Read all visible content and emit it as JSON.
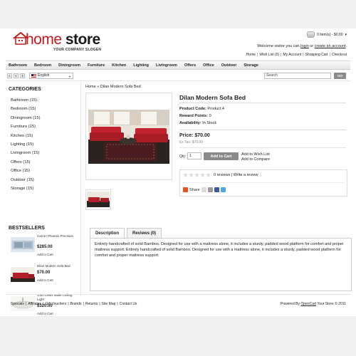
{
  "header": {
    "logo": {
      "home": "home",
      "store": "store"
    },
    "slogan": "YOUR COMPANY SLOGEN",
    "cart_text": "0 item(s) - $0.00",
    "welcome": {
      "prefix": "Welcome visitor you can ",
      "login": "login",
      "middle": " or ",
      "create": "create an account",
      "suffix": "."
    },
    "toplinks": [
      "Home",
      "Wish List (0)",
      "My Account",
      "Shopping Cart",
      "Checkout"
    ]
  },
  "menu": [
    "Bathroom",
    "Bedroom",
    "Diningroom",
    "Furniture",
    "Kitchen",
    "Lighting",
    "Livingroom",
    "Offers",
    "Office",
    "Outdoor",
    "Storage"
  ],
  "toolbar": {
    "currencies": [
      "£",
      "€",
      "$"
    ],
    "language": "English",
    "search_placeholder": "Search",
    "go_label": "GO"
  },
  "sidebar": {
    "categories_title": "CATEGORIES",
    "categories": [
      "Bathroom (15)",
      "Bedroom (15)",
      "Diningroom (15)",
      "Furniture (15)",
      "Kitchen (15)",
      "Lighting (15)",
      "Livingroom (15)",
      "Offers (15)",
      "Office (15)",
      "Outdoor (15)",
      "Storage (15)"
    ],
    "bestsellers_title": "BESTSELLERS",
    "bestsellers": [
      {
        "name": "Carron Phoenix Precision",
        "price": "$285.00",
        "cart": "Add to Cart"
      },
      {
        "name": "Dilan Modern Sofa Bed",
        "price": "$70.00",
        "cart": "Add to Cart"
      },
      {
        "name": "John Lewis Malie Ceiling Light",
        "price": "$320.00",
        "cart": "Add to Cart"
      }
    ]
  },
  "breadcrumb": {
    "home": "Home",
    "sep": "»",
    "current": "Dilan Modern Sofa Bed"
  },
  "product": {
    "title": "Dilan Modern Sofa Bed",
    "code_label": "Product Code:",
    "code_value": "Product 4",
    "reward_label": "Reward Points:",
    "reward_value": "0",
    "avail_label": "Availability:",
    "avail_value": "In Stock",
    "price": "Price: $70.00",
    "ex_tax": "Ex Tax: $70.00",
    "qty_label": "Qty:",
    "qty_value": "1",
    "add_to_cart": "Add to Cart",
    "wishlist": "Add to Wish List",
    "compare": "Add to Compare",
    "reviews": "0 reviews",
    "review_sep": "|",
    "write_review": "Write a review",
    "share": "Share"
  },
  "tabs": {
    "description": "Description",
    "reviews": "Reviews (0)"
  },
  "description": "Entirely handcrafted of solid Bamboo. Designed for use with a mattress alone, it includes a sturdy, padded wood platform for comfort and proper mattress support. Entirely handcrafted of solid Bamboo. Designed for use with a mattress alone, it includes a sturdy, padded wood platform for comfort and proper mattress support.",
  "footer": {
    "links": [
      "Specials",
      "Affiliates",
      "Gift Vouchers",
      "Brands",
      "Returns",
      "Site Map",
      "Contact Us"
    ],
    "powered_prefix": "Powered By ",
    "powered_link": "OpenCart",
    "powered_suffix": " Your Store © 2011"
  },
  "colors": {
    "logo_home": "#c41a1a",
    "button_gray": "#8a8a8a",
    "share_orange": "#e8521c"
  }
}
